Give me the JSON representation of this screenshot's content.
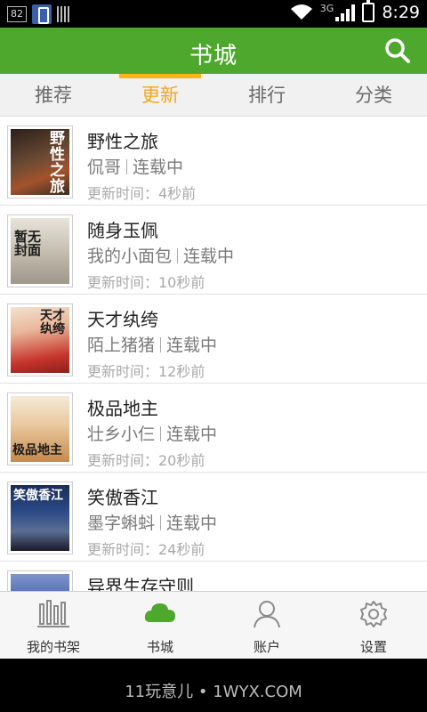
{
  "status_bar": {
    "notif_count": "82",
    "network": "3G",
    "time": "8:29"
  },
  "header": {
    "title": "书城",
    "search_icon": "search-icon"
  },
  "tabs": [
    {
      "label": "推荐",
      "active": false
    },
    {
      "label": "更新",
      "active": true
    },
    {
      "label": "排行",
      "active": false
    },
    {
      "label": "分类",
      "active": false
    }
  ],
  "books": [
    {
      "title": "野性之旅",
      "author": "侃哥",
      "status": "连载中",
      "updated": "更新时间：4秒前",
      "cover_text": "野性之旅",
      "cover_color": "#5a3a2a"
    },
    {
      "title": "随身玉佩",
      "author": "我的小面包",
      "status": "连载中",
      "updated": "更新时间：10秒前",
      "cover_text": "暂无封面",
      "cover_color": "#d9d4c8"
    },
    {
      "title": "天才纨绔",
      "author": "陌上猪猪",
      "status": "连载中",
      "updated": "更新时间：12秒前",
      "cover_text": "天才纨绔",
      "cover_color": "#c9443a"
    },
    {
      "title": "极品地主",
      "author": "壮乡小仨",
      "status": "连载中",
      "updated": "更新时间：20秒前",
      "cover_text": "极品地主",
      "cover_color": "#e8d9c2"
    },
    {
      "title": "笑傲香江",
      "author": "墨字蝌蚪",
      "status": "连载中",
      "updated": "更新时间：24秒前",
      "cover_text": "笑傲香江",
      "cover_color": "#223a66"
    },
    {
      "title": "异界生存守则",
      "author": "",
      "status": "",
      "updated": "",
      "cover_text": "",
      "cover_color": "#3355aa"
    }
  ],
  "bottom_nav": [
    {
      "label": "我的书架",
      "icon": "bookshelf-icon"
    },
    {
      "label": "书城",
      "icon": "cloud-icon"
    },
    {
      "label": "账户",
      "icon": "user-icon"
    },
    {
      "label": "设置",
      "icon": "gear-icon"
    }
  ],
  "footer": {
    "watermark": "11玩意儿 • 1WYX.COM"
  },
  "colors": {
    "brand_green": "#4ea82d",
    "tab_active": "#f3a71e"
  }
}
